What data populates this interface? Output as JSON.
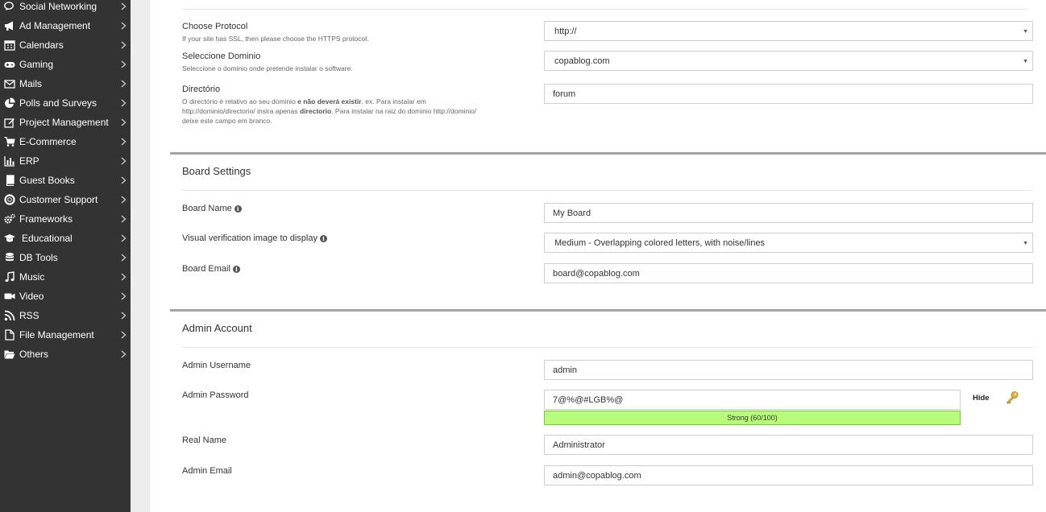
{
  "sidebar": {
    "items": [
      {
        "label": "Social Networking",
        "icon": "chat-bubbles-icon"
      },
      {
        "label": "Ad Management",
        "icon": "megaphone-icon"
      },
      {
        "label": "Calendars",
        "icon": "calendar-icon"
      },
      {
        "label": "Gaming",
        "icon": "gamepad-icon"
      },
      {
        "label": "Mails",
        "icon": "envelope-icon"
      },
      {
        "label": "Polls and Surveys",
        "icon": "pie-chart-icon"
      },
      {
        "label": "Project Management",
        "icon": "edit-icon"
      },
      {
        "label": "E-Commerce",
        "icon": "cart-icon"
      },
      {
        "label": "ERP",
        "icon": "bar-chart-icon"
      },
      {
        "label": "Guest Books",
        "icon": "book-icon"
      },
      {
        "label": "Customer Support",
        "icon": "lifebuoy-icon"
      },
      {
        "label": "Frameworks",
        "icon": "cogs-icon"
      },
      {
        "label": "Educational",
        "icon": "graduation-cap-icon"
      },
      {
        "label": "DB Tools",
        "icon": "database-icon"
      },
      {
        "label": "Music",
        "icon": "music-icon"
      },
      {
        "label": "Video",
        "icon": "video-camera-icon"
      },
      {
        "label": "RSS",
        "icon": "rss-icon"
      },
      {
        "label": "File Management",
        "icon": "file-icon"
      },
      {
        "label": "Others",
        "icon": "folder-open-icon"
      }
    ]
  },
  "software_setup": {
    "protocol": {
      "label": "Choose Protocol",
      "description": "If your site has SSL, then please choose the HTTPS protocol.",
      "value": "http://"
    },
    "domain": {
      "label": "Seleccione Dominio",
      "description": "Seleccione o dominio onde pretende instalar o software.",
      "value": "copablog.com"
    },
    "directory": {
      "label": "Directório",
      "desc_line1_a": "O directório é relativo ao seu dominio ",
      "desc_line1_b": "e não deverá existir",
      "desc_line1_c": ". ex. Para instalar em",
      "desc_line2_a": "http://dominio/directorio/ insira apenas ",
      "desc_line2_b": "directorio",
      "desc_line2_c": ". Para instalar na raiz do dominio http://dominio/",
      "desc_line3": "deixe este campo em branco.",
      "value": "forum"
    }
  },
  "board_settings": {
    "title": "Board Settings",
    "board_name": {
      "label": "Board Name",
      "value": "My Board"
    },
    "captcha": {
      "label": "Visual verification image to display",
      "value": "Medium - Overlapping colored letters, with noise/lines"
    },
    "board_email": {
      "label": "Board Email",
      "value": "board@copablog.com"
    }
  },
  "admin_account": {
    "title": "Admin Account",
    "username": {
      "label": "Admin Username",
      "value": "admin"
    },
    "password": {
      "label": "Admin Password",
      "value": "7@%@#LGB%@",
      "strength": "Strong (60/100)",
      "strength_color": "#b7fd7b",
      "hide_label": "Hide"
    },
    "real_name": {
      "label": "Real Name",
      "value": "Administrator"
    },
    "email": {
      "label": "Admin Email",
      "value": "admin@copablog.com"
    }
  },
  "info_icon_glyph": "i"
}
